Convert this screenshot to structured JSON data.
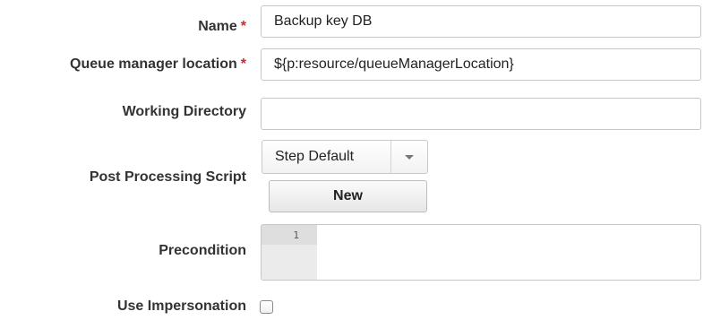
{
  "fields": {
    "name": {
      "label": "Name",
      "required_mark": "*",
      "value": "Backup key DB"
    },
    "queue_manager_location": {
      "label": "Queue manager location",
      "required_mark": "*",
      "value": "${p:resource/queueManagerLocation}"
    },
    "working_directory": {
      "label": "Working Directory",
      "value": ""
    },
    "post_processing_script": {
      "label": "Post Processing Script",
      "selected": "Step Default",
      "new_button": "New"
    },
    "precondition": {
      "label": "Precondition",
      "line_number": "1"
    },
    "use_impersonation": {
      "label": "Use Impersonation",
      "checked": false
    }
  },
  "colors": {
    "required": "#dd2222",
    "label": "#333333",
    "gutter": "#ebebeb"
  }
}
